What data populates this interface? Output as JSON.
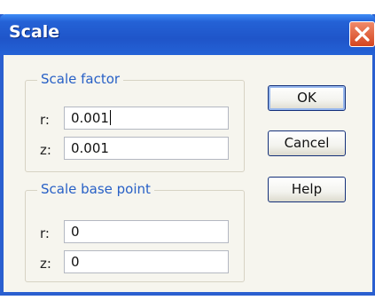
{
  "window": {
    "title": "Scale"
  },
  "scale_factor": {
    "legend": "Scale factor",
    "r_label": "r:",
    "r_value": "0.001",
    "z_label": "z:",
    "z_value": "0.001"
  },
  "scale_base_point": {
    "legend": "Scale base point",
    "r_label": "r:",
    "r_value": "0",
    "z_label": "z:",
    "z_value": "0"
  },
  "buttons": {
    "ok": "OK",
    "cancel": "Cancel",
    "help": "Help"
  },
  "icons": {
    "close": "close-icon"
  },
  "colors": {
    "title_bar": "#2462d6",
    "close_button": "#d5451f",
    "group_legend": "#2860c6"
  }
}
